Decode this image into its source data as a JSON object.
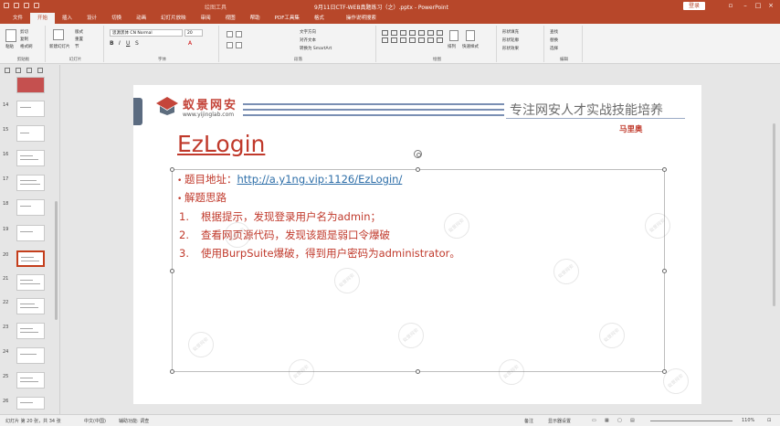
{
  "titlebar": {
    "context": "绘图工具",
    "document": "9月11日CTF-WEB真题练习（之）.pptx - PowerPoint",
    "login": "登录"
  },
  "tabs": [
    "文件",
    "开始",
    "插入",
    "设计",
    "切换",
    "动画",
    "幻灯片放映",
    "审阅",
    "视图",
    "帮助",
    "PDF工具集",
    "格式"
  ],
  "tellme": "操作说明搜索",
  "ribbon": {
    "clipboard": {
      "paste": "粘贴",
      "cut": "剪切",
      "copy": "复制",
      "format_painter": "格式刷",
      "label": "剪贴板"
    },
    "slides": {
      "new_slide": "新建幻灯片",
      "layout": "版式",
      "reset": "重置",
      "section": "节",
      "label": "幻灯片"
    },
    "font": {
      "name": "思源黑体 CN Normal",
      "size": "20",
      "label": "字体"
    },
    "paragraph": {
      "text_direction": "文字方向",
      "align_text": "对齐文本",
      "smartart": "转换为 SmartArt",
      "label": "段落"
    },
    "drawing": {
      "arrange": "排列",
      "quick_styles": "快速样式",
      "shape_fill": "形状填充",
      "shape_outline": "形状轮廓",
      "shape_effects": "形状效果",
      "label": "绘图"
    },
    "editing": {
      "find": "查找",
      "replace": "替换",
      "select": "选择",
      "label": "编辑"
    }
  },
  "thumbnails": {
    "numbers": [
      "14",
      "15",
      "16",
      "17",
      "18",
      "19",
      "20",
      "21",
      "22",
      "23",
      "24",
      "25",
      "26"
    ],
    "selected": "20"
  },
  "slide": {
    "logo_cn": "蚁景网安",
    "logo_url": "www.yijinglab.com",
    "tagline": "专注网安人才实战技能培养",
    "author": "马里奥",
    "title": "EzLogin",
    "bullets": [
      {
        "label": "题目地址：",
        "link": "http://a.y1ng.vip:1126/EzLogin/"
      },
      {
        "label": "解题思路",
        "link": ""
      }
    ],
    "steps": [
      {
        "n": "1.",
        "text": "根据提示，发现登录用户名为admin；"
      },
      {
        "n": "2.",
        "text": "查看网页源代码，发现该题是弱口令爆破"
      },
      {
        "n": "3.",
        "text": "使用BurpSuite爆破，得到用户密码为admin⁠istrator。"
      }
    ],
    "watermark": "蚁景网安"
  },
  "statusbar": {
    "slide_pos": "幻灯片 第 20 张，共 34 张",
    "lang": "中文(中国)",
    "accessibility": "辅助功能: 调查",
    "notes": "备注",
    "comments": "显示器设置",
    "zoom": "110%"
  },
  "colors": {
    "accent": "#b7472a",
    "title_red": "#c0392b",
    "link_blue": "#2d6ea8"
  }
}
